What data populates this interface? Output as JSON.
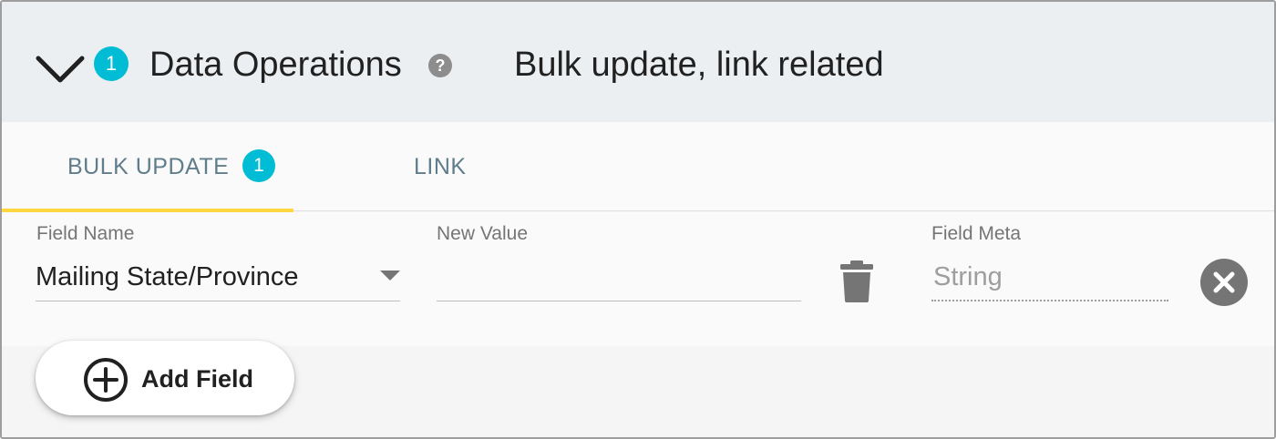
{
  "header": {
    "count_badge": "1",
    "title": "Data Operations",
    "help_glyph": "?",
    "summary": "Bulk update, link related",
    "expand_icon": "chevron-down-icon"
  },
  "tabs": [
    {
      "label": "BULK UPDATE",
      "badge": "1",
      "active": true
    },
    {
      "label": "LINK",
      "active": false
    }
  ],
  "row": {
    "field_name_label": "Field Name",
    "field_name_value": "Mailing State/Province",
    "new_value_label": "New Value",
    "new_value": "",
    "field_meta_label": "Field Meta",
    "field_meta_value": "String"
  },
  "actions": {
    "add_field_label": "Add Field"
  },
  "colors": {
    "badge": "#00bcd4",
    "tab_active_indicator": "#ffd740",
    "tab_text": "#607d8b",
    "header_bg": "#eceff1"
  }
}
